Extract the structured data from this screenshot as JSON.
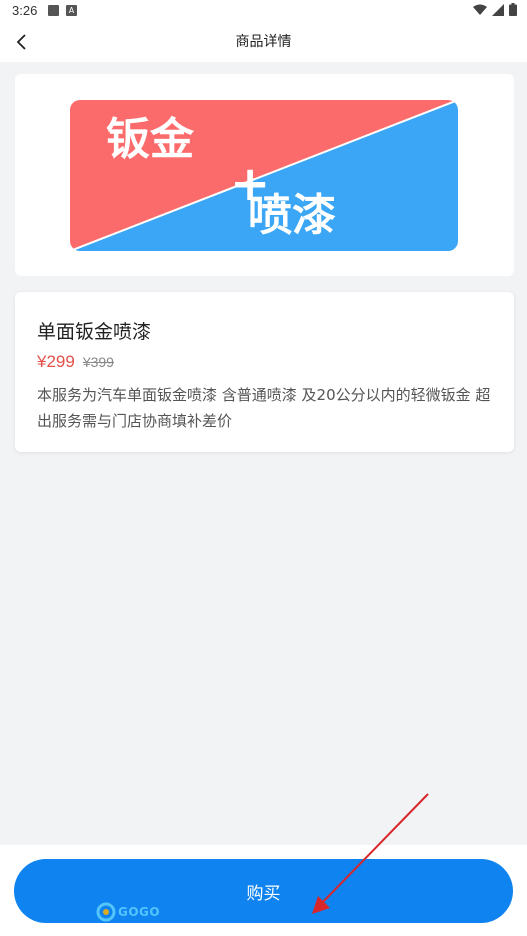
{
  "status_bar": {
    "time": "3:26"
  },
  "header": {
    "title": "商品详情"
  },
  "banner": {
    "line1": "钣金",
    "plus": "+",
    "line2": "喷漆",
    "colors": {
      "left": "#fc6b6b",
      "right": "#3ba6f5"
    }
  },
  "product": {
    "name": "单面钣金喷漆",
    "price": "¥299",
    "original_price": "¥399",
    "description": "本服务为汽车单面钣金喷漆 含普通喷漆 及20公分以内的轻微钣金 超出服务需与门店协商填补差价"
  },
  "bottom": {
    "buy_label": "购买"
  },
  "watermark": {
    "text": "GOGO"
  },
  "colors": {
    "accent": "#0f84f0",
    "price": "#e2524b",
    "annotation_arrow": "#d8262a"
  }
}
